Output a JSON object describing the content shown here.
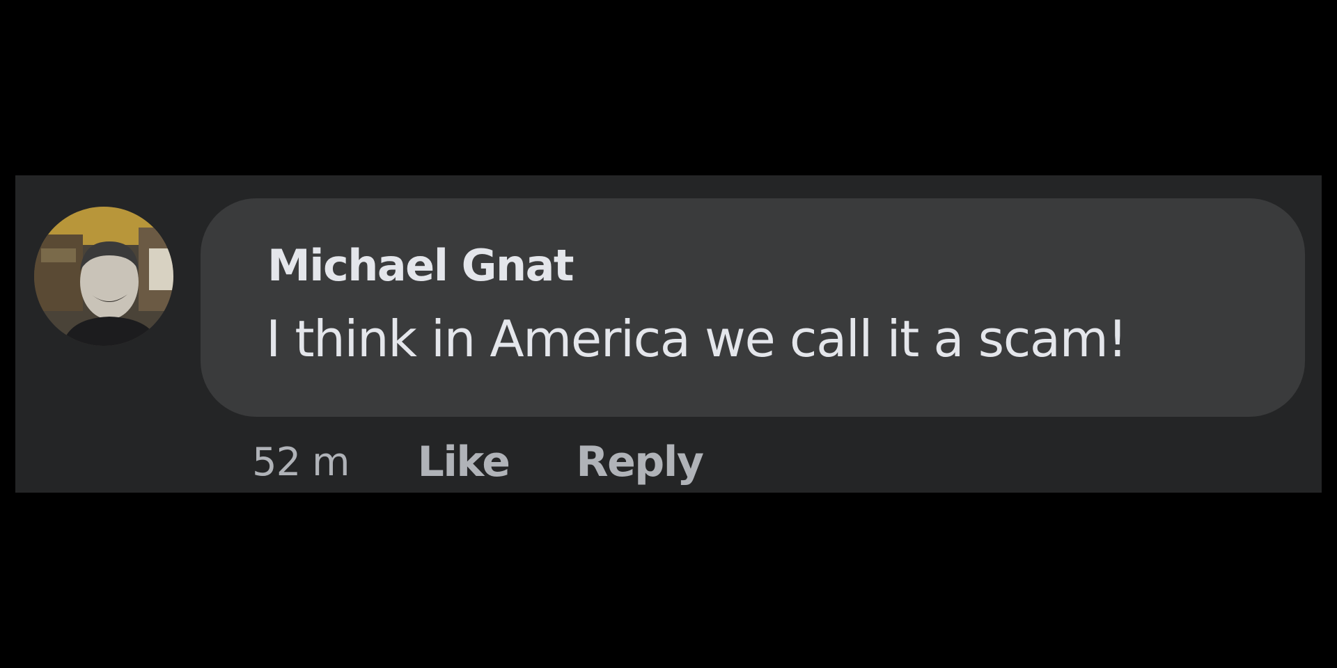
{
  "comment": {
    "author": "Michael Gnat",
    "text": "I think in America we call it a scam!",
    "timestamp": "52 m",
    "like_label": "Like",
    "reply_label": "Reply",
    "avatar_icon": "user-photo-avatar"
  },
  "colors": {
    "background": "#000000",
    "card": "#242526",
    "bubble": "#3a3b3c",
    "primary_text": "#e4e6eb",
    "secondary_text": "#b0b3b8"
  }
}
